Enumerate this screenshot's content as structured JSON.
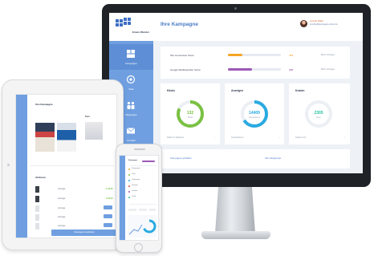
{
  "desktop": {
    "logo_text": "Einem Wunder",
    "page_title": "Ihre Kampagne",
    "user": {
      "name": "Jennifer Müller",
      "email": "jennifer@kampagne-online.de"
    },
    "sidebar": [
      {
        "label": "Kampagne",
        "icon": "dashboard-icon",
        "active": true
      },
      {
        "label": "Ziele",
        "icon": "target-icon",
        "active": false
      },
      {
        "label": "Zielgruppe",
        "icon": "audience-icon",
        "active": false
      },
      {
        "label": "Kontakt",
        "icon": "mail-icon",
        "active": false
      }
    ],
    "metrics": [
      {
        "label": "Ihre Conversion Score",
        "value": "474",
        "fill": 0.27,
        "color": "#f5a623",
        "link": "Mehr anzeigen"
      },
      {
        "label": "Google Wettbewerber Score",
        "value": "378",
        "fill": 0.45,
        "color": "#9b59b6",
        "link": "Mehr anzeigen"
      }
    ],
    "donuts": [
      {
        "title": "Klicks",
        "value": "132",
        "sub": "Klicks",
        "color": "#7ac143",
        "fraction": 0.82,
        "link": "Klicks im Zeitraum"
      },
      {
        "title": "Anzeigen",
        "value": "14409",
        "sub": "Impressionen",
        "color": "#29aae1",
        "fraction": 0.66,
        "link": "Impressionen"
      },
      {
        "title": "Kosten",
        "value": "2305",
        "sub": "Euro",
        "color": "#2bc4a0",
        "fraction": 0.0,
        "link": "Kosten in €"
      }
    ],
    "bottom_links": [
      "Kampagne anhalten",
      "Ihre Zielgruppe"
    ]
  },
  "tablet": {
    "title": "Ihre Kampagne",
    "subtitle": "Text",
    "section": "Aktionen",
    "button": "Kampagne bearbeiten",
    "rows": [
      {
        "text": "Anzeige",
        "price": "€ 49,00"
      },
      {
        "text": "Anzeige",
        "price": "€ 29,00"
      },
      {
        "text": "Anzeige",
        "price": ""
      },
      {
        "text": "Anzeige",
        "price": ""
      },
      {
        "text": "Anzeige",
        "price": ""
      }
    ]
  },
  "phone": {
    "title": "Kampagne",
    "items": [
      "Kampagne",
      "Ziele",
      "Zielgruppe",
      "Statistik",
      "Kontakt",
      "Profil"
    ]
  }
}
